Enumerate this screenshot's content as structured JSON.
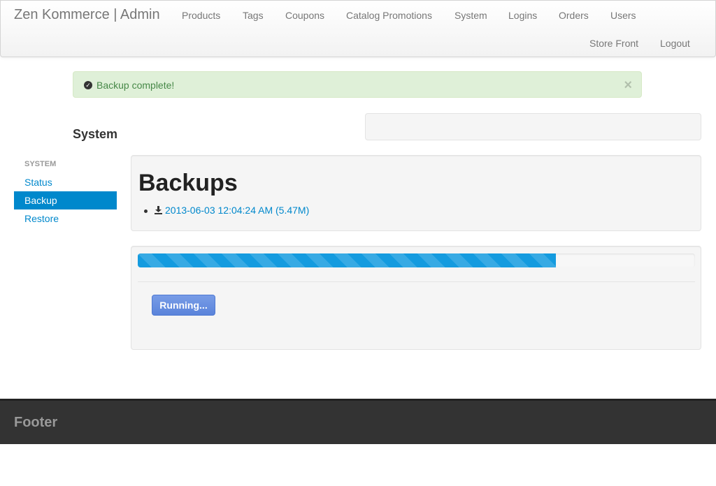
{
  "navbar": {
    "brand": "Zen Kommerce | Admin",
    "links": [
      "Products",
      "Tags",
      "Coupons",
      "Catalog Promotions",
      "System",
      "Logins",
      "Orders",
      "Users"
    ],
    "right_links": [
      "Store Front",
      "Logout"
    ]
  },
  "alert": {
    "message": "Backup complete!",
    "close": "×",
    "color": "#468847",
    "background": "#dff0d8"
  },
  "page": {
    "title": "System"
  },
  "sidebar": {
    "header": "SYSTEM",
    "items": [
      {
        "label": "Status",
        "active": false
      },
      {
        "label": "Backup",
        "active": true
      },
      {
        "label": "Restore",
        "active": false
      }
    ]
  },
  "backups": {
    "heading": "Backups",
    "items": [
      {
        "label": "2013-06-03 12:04:24 AM (5.47M)",
        "icon": "download-icon"
      }
    ]
  },
  "progress": {
    "percent": 75,
    "color": "#149bdf"
  },
  "run_button": {
    "label": "Running..."
  },
  "footer": {
    "text": "Footer"
  },
  "colors": {
    "link": "#0088cc",
    "footer_bg": "#333333"
  }
}
